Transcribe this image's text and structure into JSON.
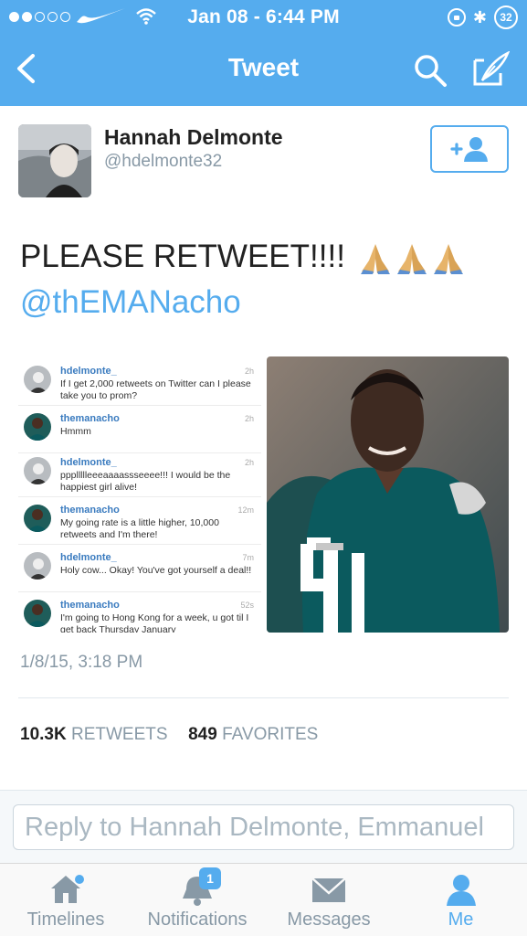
{
  "status_bar": {
    "time": "Jan 08 - 6:44 PM",
    "battery": "32"
  },
  "nav": {
    "title": "Tweet"
  },
  "tweet": {
    "name": "Hannah Delmonte",
    "handle": "@hdelmonte32",
    "text": "PLEASE RETWEET!!!!",
    "mention": "@thEMANacho",
    "timestamp": "1/8/15, 3:18 PM",
    "retweets_count": "10.3K",
    "retweets_label": "RETWEETS",
    "favorites_count": "849",
    "favorites_label": "FAVORITES"
  },
  "dm_thread": [
    {
      "user": "hdelmonte_",
      "time": "2h",
      "message": "If I get 2,000 retweets on Twitter can I please take you to prom?"
    },
    {
      "user": "themanacho",
      "time": "2h",
      "message": "Hmmm"
    },
    {
      "user": "hdelmonte_",
      "time": "2h",
      "message": "pppllllleeeaaaassseeee!!! I would be the happiest girl alive!"
    },
    {
      "user": "themanacho",
      "time": "12m",
      "message": "My going rate is a little higher, 10,000 retweets and I'm there!"
    },
    {
      "user": "hdelmonte_",
      "time": "7m",
      "message": "Holy cow... Okay! You've got yourself a deal!!"
    },
    {
      "user": "themanacho",
      "time": "52s",
      "message": "I'm going to Hong Kong for a week, u got til I get back Thursday January"
    }
  ],
  "reply": {
    "placeholder": "Reply to Hannah Delmonte, Emmanuel"
  },
  "tabs": [
    {
      "label": "Timelines",
      "icon": "home-icon"
    },
    {
      "label": "Notifications",
      "icon": "bell-icon",
      "badge": "1"
    },
    {
      "label": "Messages",
      "icon": "envelope-icon"
    },
    {
      "label": "Me",
      "icon": "person-icon",
      "active": true
    }
  ],
  "colors": {
    "accent": "#55acee",
    "text": "#222222",
    "muted": "#8899a6",
    "jersey": "#0b5a5e"
  }
}
